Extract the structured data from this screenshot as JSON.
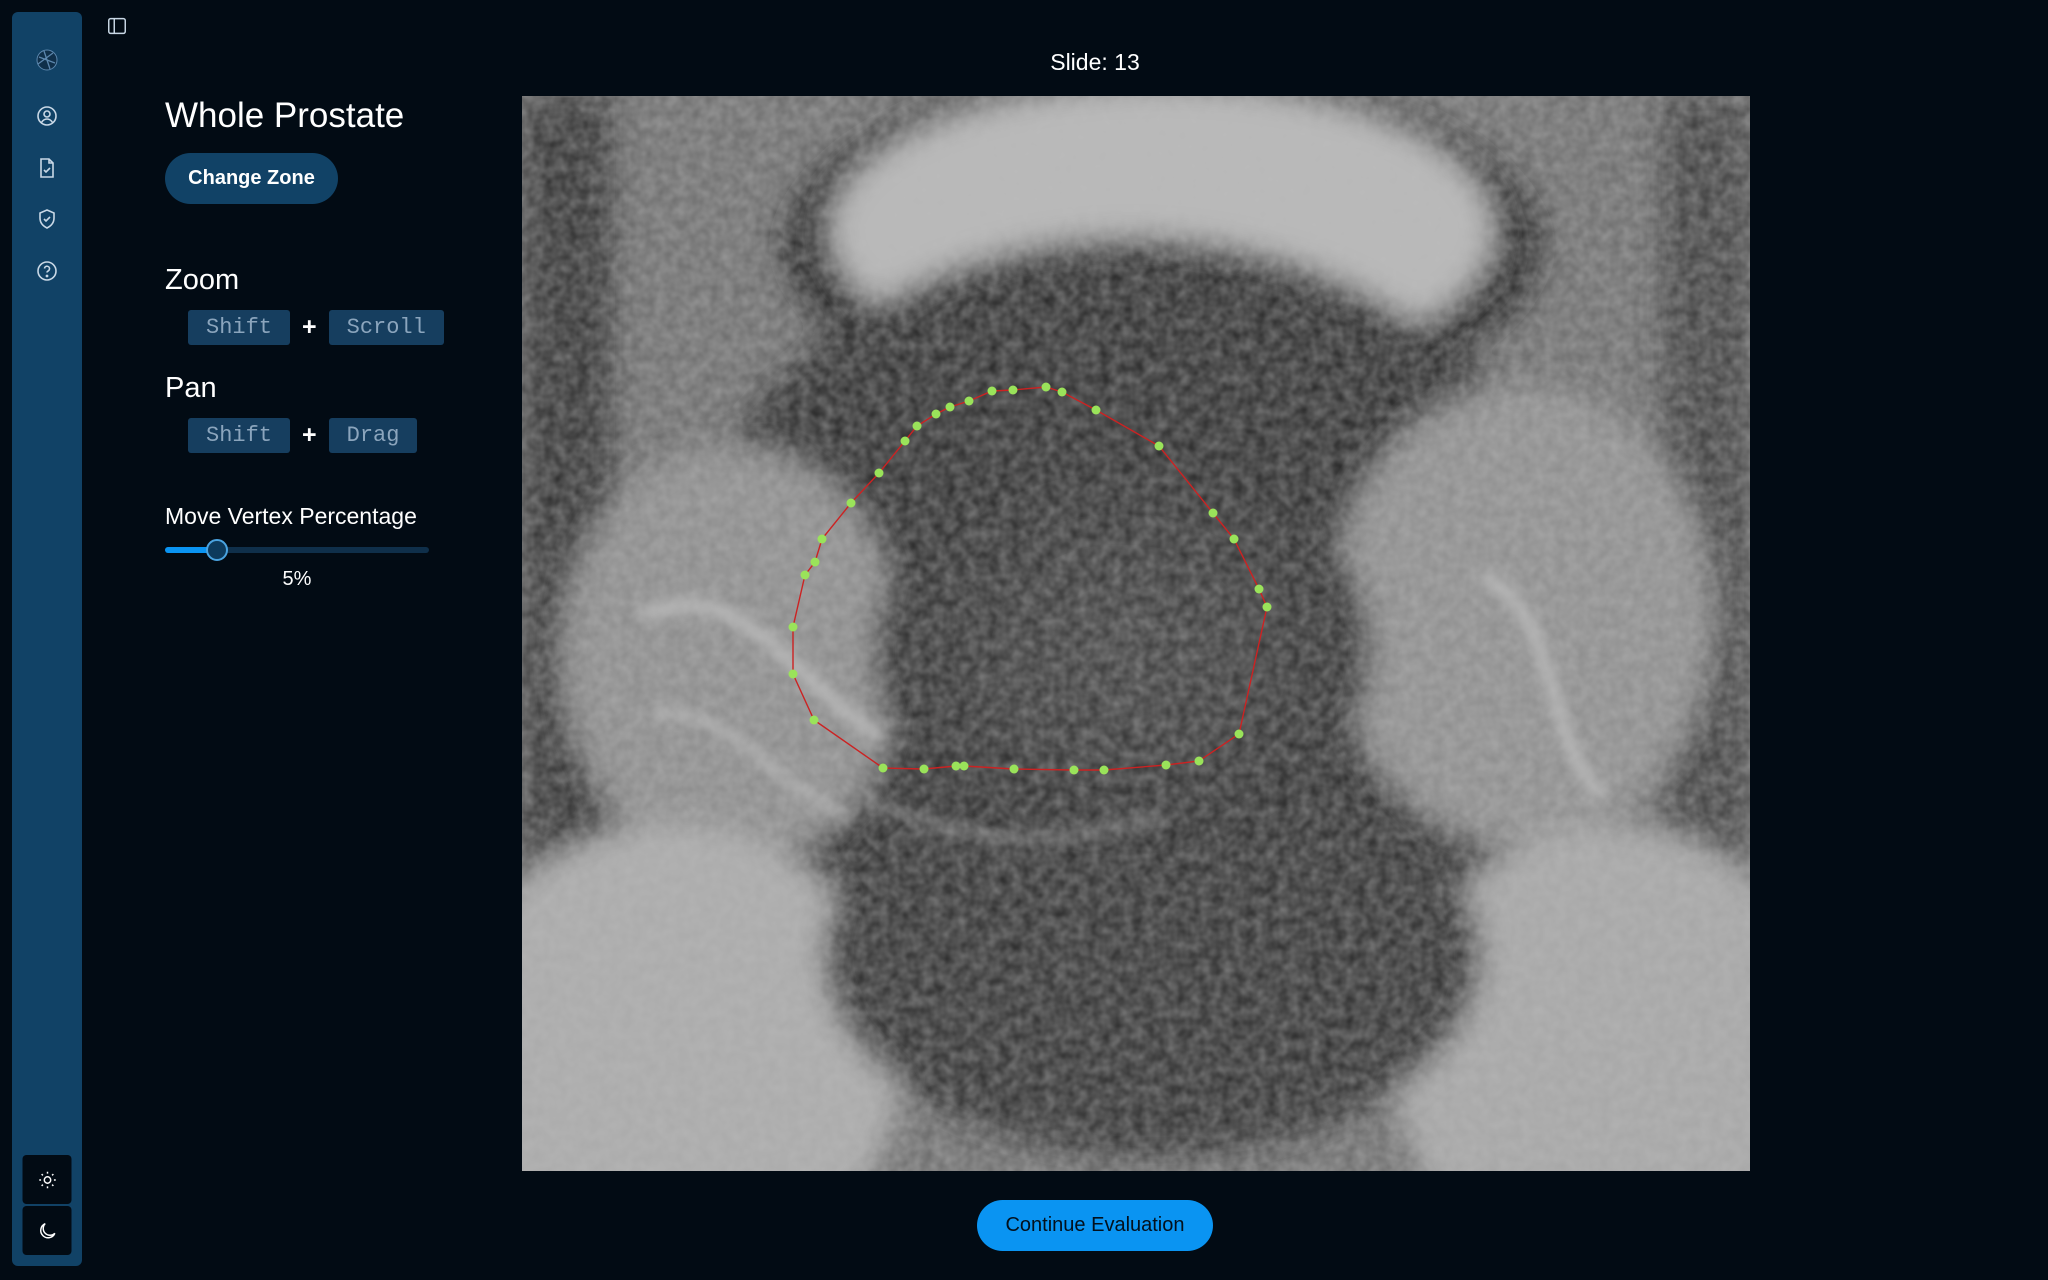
{
  "sidebar": {
    "items": [
      {
        "icon": "logo-icon"
      },
      {
        "icon": "user-circle-icon"
      },
      {
        "icon": "document-check-icon"
      },
      {
        "icon": "shield-check-icon"
      },
      {
        "icon": "help-circle-icon"
      }
    ],
    "theme": {
      "light_icon": "sun-icon",
      "dark_icon": "moon-icon"
    },
    "panel_toggle_icon": "panel-left-icon",
    "background_color": "#114266"
  },
  "panel": {
    "zone_title": "Whole Prostate",
    "change_zone_label": "Change Zone",
    "zoom": {
      "heading": "Zoom",
      "key1": "Shift",
      "plus": "+",
      "key2": "Scroll"
    },
    "pan": {
      "heading": "Pan",
      "key1": "Shift",
      "plus": "+",
      "key2": "Drag"
    },
    "move_vertex": {
      "label": "Move Vertex Percentage",
      "value": 5,
      "value_label": "5%",
      "min": 0,
      "max": 100
    }
  },
  "viewer": {
    "slide_label": "Slide: 13",
    "contour_color": "#cc2222",
    "vertex_color": "#9ae35a"
  },
  "continue_label": "Continue Evaluation",
  "colors": {
    "accent": "#0a94f2",
    "background": "#020b14",
    "button_dark": "#114266"
  }
}
